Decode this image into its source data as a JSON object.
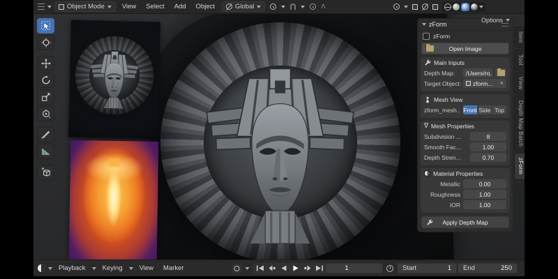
{
  "topbar": {
    "mode": "Object Mode",
    "menus": [
      "View",
      "Select",
      "Add",
      "Object"
    ],
    "orientation": "Global",
    "options_label": "Options",
    "shading_modes": [
      "wireframe",
      "solid",
      "material-preview",
      "rendered"
    ],
    "active_shading": "material-preview"
  },
  "toolbar": {
    "tools": [
      "select-box",
      "cursor",
      "move",
      "rotate",
      "scale",
      "transform",
      "annotate",
      "measure",
      "add-cube"
    ],
    "active_tool": "select-box"
  },
  "panel": {
    "title": "zForm",
    "checkbox_label": "zForm",
    "open_image_label": "Open Image",
    "main_inputs": {
      "title": "Main Inputs",
      "depth_map_label": "Depth Map:",
      "depth_map_value": "/Users/ro...",
      "target_label": "Target Object:",
      "target_value": "zform..."
    },
    "mesh_view": {
      "title": "Mesh View",
      "object_name": "zform_mesh...",
      "views": [
        "Front",
        "Side",
        "Top"
      ],
      "active_view": "Front"
    },
    "mesh_props": {
      "title": "Mesh Properties",
      "rows": [
        {
          "label": "Subdivision ...",
          "value": "8"
        },
        {
          "label": "Smooth Fac...",
          "value": "1.00"
        },
        {
          "label": "Depth Stren...",
          "value": "0.70"
        }
      ]
    },
    "material_props": {
      "title": "Material Properties",
      "rows": [
        {
          "label": "Metallic",
          "value": "0.00"
        },
        {
          "label": "Roughness",
          "value": "1.00"
        },
        {
          "label": "IOR",
          "value": "1.00"
        }
      ]
    },
    "apply_label": "Apply Depth Map"
  },
  "side_tabs": {
    "items": [
      "Item",
      "Tool",
      "View",
      "Depth Map Batch",
      "zForm"
    ],
    "active": "zForm"
  },
  "timeline": {
    "menus": [
      "Playback",
      "Keying",
      "View",
      "Marker"
    ],
    "transport": [
      "jump-to-start",
      "previous-keyframe",
      "play-reverse",
      "play",
      "next-keyframe",
      "jump-to-end"
    ],
    "current_frame": "1",
    "start_label": "Start",
    "start_value": "1",
    "end_label": "End",
    "end_value": "250"
  },
  "colors": {
    "accent_blue": "#4772b3",
    "panel_bg": "#2d2d2d",
    "viewport_bg": "#2b2c2e",
    "depth_map_palette": [
      "#2c1156",
      "#a93a34",
      "#ef7c24",
      "#fcc84f",
      "#fff7d2"
    ]
  }
}
